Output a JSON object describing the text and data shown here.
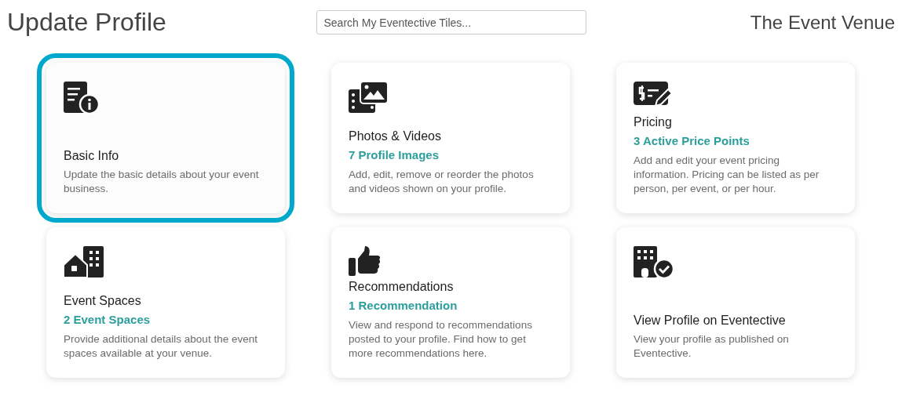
{
  "header": {
    "title": "Update Profile",
    "search": {
      "placeholder": "Search My Eventective Tiles..."
    },
    "venue": "The Event Venue"
  },
  "tiles": [
    {
      "kind": "info",
      "title": "Basic Info",
      "description": "Update the basic details about your event business.",
      "selected": true
    },
    {
      "kind": "media",
      "title": "Photos & Videos",
      "subtitle": "7 Profile Images",
      "description": "Add, edit, remove or reorder the photos and videos shown on your profile.",
      "selected": false
    },
    {
      "kind": "pricing",
      "title": "Pricing",
      "subtitle": "3 Active Price Points",
      "description": "Add and edit your event pricing information. Pricing can be listed as per person, per event, or per hour.",
      "selected": false
    },
    {
      "kind": "spaces",
      "title": "Event Spaces",
      "subtitle": "2 Event Spaces",
      "description": "Provide additional details about the event spaces available at your venue.",
      "selected": false
    },
    {
      "kind": "recommendations",
      "title": "Recommendations",
      "subtitle": "1 Recommendation",
      "description": "View and respond to recommendations posted to your profile. Find how to get more recommendations here.",
      "selected": false
    },
    {
      "kind": "profile",
      "title": "View Profile on Eventective",
      "description": "View your profile as published on Eventective.",
      "selected": false
    }
  ]
}
